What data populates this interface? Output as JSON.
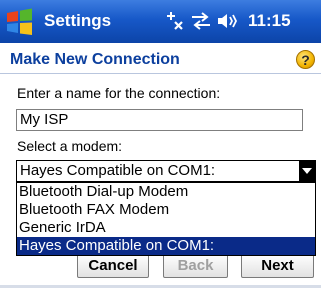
{
  "titlebar": {
    "app_title": "Settings",
    "time": "11:15",
    "icons": [
      "start-logo-icon",
      "connectivity-icon",
      "network-sync-icon",
      "speaker-icon"
    ]
  },
  "header": {
    "title": "Make New Connection",
    "help_label": "?"
  },
  "form": {
    "name_label": "Enter a name for the connection:",
    "name_value": "My ISP",
    "modem_label": "Select a modem:",
    "modem_selected": "Hayes Compatible on COM1:",
    "modem_options": [
      "Bluetooth Dial-up Modem",
      "Bluetooth FAX Modem",
      "Generic IrDA",
      "Hayes Compatible on COM1:"
    ]
  },
  "buttons": {
    "cancel": "Cancel",
    "back": "Back",
    "next": "Next"
  },
  "colors": {
    "title_bar": "#1758c8",
    "header_text": "#0c3f9e",
    "selection": "#0a2a88"
  }
}
